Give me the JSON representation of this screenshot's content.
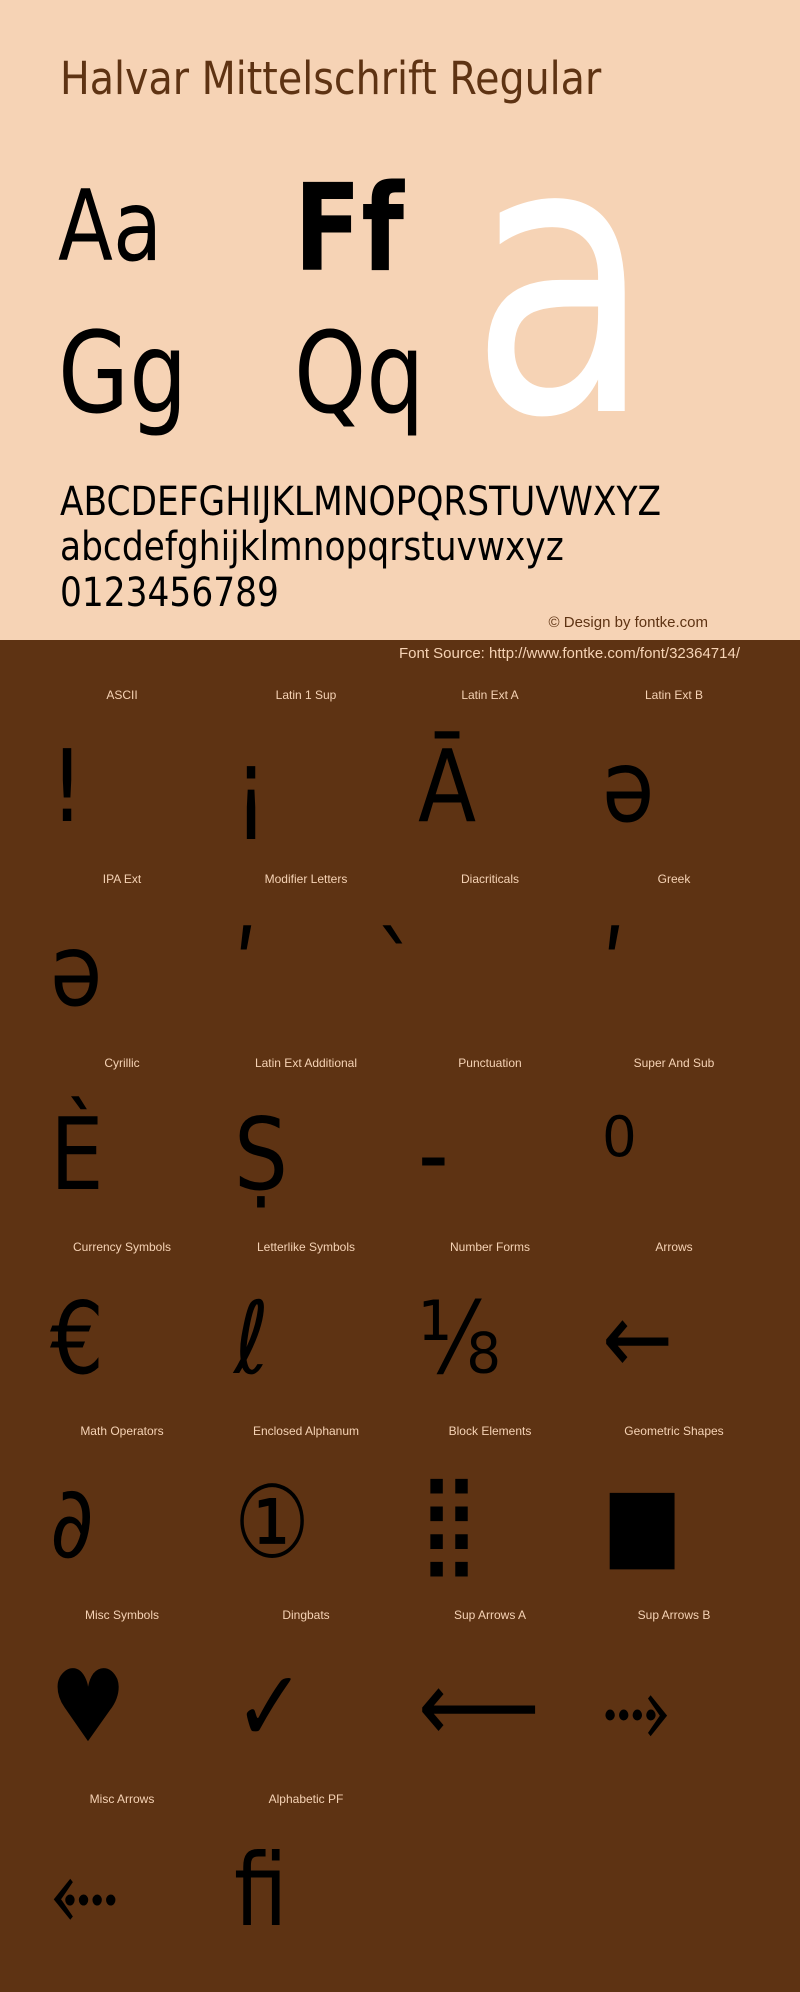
{
  "header": {
    "title": "Halvar Mittelschrift Regular"
  },
  "specimen": {
    "pairs": [
      "Aa",
      "Ff",
      "Gg",
      "Qq"
    ],
    "hero_glyph": "a",
    "uppercase": "ABCDEFGHIJKLMNOPQRSTUVWXYZ",
    "lowercase": "abcdefghijklmnopqrstuvwxyz",
    "digits": "0123456789",
    "credit": "© Design by fontke.com"
  },
  "source": {
    "text": "Font Source: http://www.fontke.com/font/32364714/"
  },
  "colors": {
    "top_background": "#F6D3B5",
    "bottom_background": "#5E3313",
    "hero_glyph": "#FFFFFF",
    "glyph": "#000000"
  },
  "blocks": [
    {
      "label": "ASCII",
      "glyph": "!"
    },
    {
      "label": "Latin 1 Sup",
      "glyph": "¡"
    },
    {
      "label": "Latin Ext A",
      "glyph": "Ā"
    },
    {
      "label": "Latin Ext B",
      "glyph": "ə"
    },
    {
      "label": "IPA Ext",
      "glyph": "ə"
    },
    {
      "label": "Modifier Letters",
      "glyph": "ʹ"
    },
    {
      "label": "Diacriticals",
      "glyph": "̀"
    },
    {
      "label": "Greek",
      "glyph": "ʹ"
    },
    {
      "label": "Cyrillic",
      "glyph": "Ѐ"
    },
    {
      "label": "Latin Ext Additional",
      "glyph": "Ṣ"
    },
    {
      "label": "Punctuation",
      "glyph": "‐"
    },
    {
      "label": "Super And Sub",
      "glyph": "⁰"
    },
    {
      "label": "Currency Symbols",
      "glyph": "€"
    },
    {
      "label": "Letterlike Symbols",
      "glyph": "ℓ"
    },
    {
      "label": "Number Forms",
      "glyph": "⅛"
    },
    {
      "label": "Arrows",
      "glyph": "←"
    },
    {
      "label": "Math Operators",
      "glyph": "∂"
    },
    {
      "label": "Enclosed Alphanum",
      "glyph": "①"
    },
    {
      "label": "Block Elements",
      "glyph": "⣿"
    },
    {
      "label": "Geometric Shapes",
      "glyph": "■"
    },
    {
      "label": "Misc Symbols",
      "glyph": "♥"
    },
    {
      "label": "Dingbats",
      "glyph": "✓"
    },
    {
      "label": "Sup Arrows A",
      "glyph": "⟵"
    },
    {
      "label": "Sup Arrows B",
      "glyph": "⤑"
    },
    {
      "label": "Misc Arrows",
      "glyph": "⬸"
    },
    {
      "label": "Alphabetic PF",
      "glyph": "ﬁ"
    }
  ]
}
